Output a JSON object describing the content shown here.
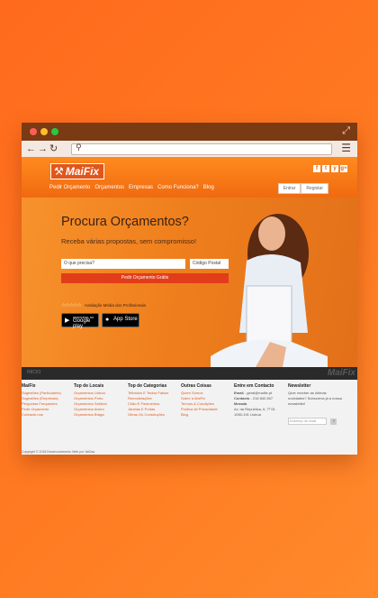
{
  "site": {
    "brand": "MaiFix",
    "nav": [
      "Pedir Orçamento",
      "Orçamentos",
      "Empresas",
      "Como Funciona?",
      "Blog"
    ],
    "social": [
      "f",
      "t",
      "y",
      "g+"
    ],
    "login": [
      "Entrar",
      "Registar"
    ]
  },
  "hero": {
    "title": "Procura Orçamentos?",
    "subtitle": "Receba várias propostas, sem compromisso!",
    "input_placeholder": "O que precisa?",
    "postal_placeholder": "Código Postal",
    "cta": "Pedir Orçamento Grátis",
    "rating_label": "Avaliação Média dos Profissionais",
    "rating": 0,
    "rating_max": 5,
    "google_small": "DISPONÍVEL NO",
    "google": "Google play",
    "apple": "App Store"
  },
  "footer": {
    "home": "INÍCIO",
    "logo": "MaiFix",
    "columns": [
      {
        "title": "MaiFix",
        "items": [
          "Sugestões (Particulares)",
          "Sugestões (Empresas)",
          "Perguntas Frequentes",
          "Pedir Orçamento",
          "Contacte-nos"
        ]
      },
      {
        "title": "Top de Locais",
        "items": [
          "Orçamentos Lisboa",
          "Orçamentos Porto",
          "Orçamentos Setúbal",
          "Orçamentos Aveiro",
          "Orçamentos Braga"
        ]
      },
      {
        "title": "Top de Categorias",
        "items": [
          "Telhados E Tectos Falsos",
          "Remodelações",
          "Chão E Pavimentos",
          "Janelas E Portas",
          "Obras Ou Construções"
        ]
      },
      {
        "title": "Outras Coisas",
        "items": [
          "Quem Somos",
          "Sobre a MaiFix",
          "Termos & Condições",
          "Política de Privacidade",
          "Blog"
        ]
      }
    ],
    "contact": {
      "title": "Entre em Contacto",
      "email_label": "Email",
      "email": "geral@maifix.pt",
      "phone_label": "Contacto",
      "phone": "218 840 807",
      "address_label": "Morada",
      "address": [
        "Av. da República, 6, 7º Dt.",
        "1050-191 Lisboa"
      ]
    },
    "newsletter": {
      "title": "Newsletter",
      "text": [
        "Quer receber as últimas",
        "novidades? Subscreva já a nossa",
        "newsletter!"
      ],
      "placeholder": "Endereço de email",
      "go": "›"
    },
    "copyright": "Copyright © 2018 Desenvolvimento Web por VaiDas"
  }
}
